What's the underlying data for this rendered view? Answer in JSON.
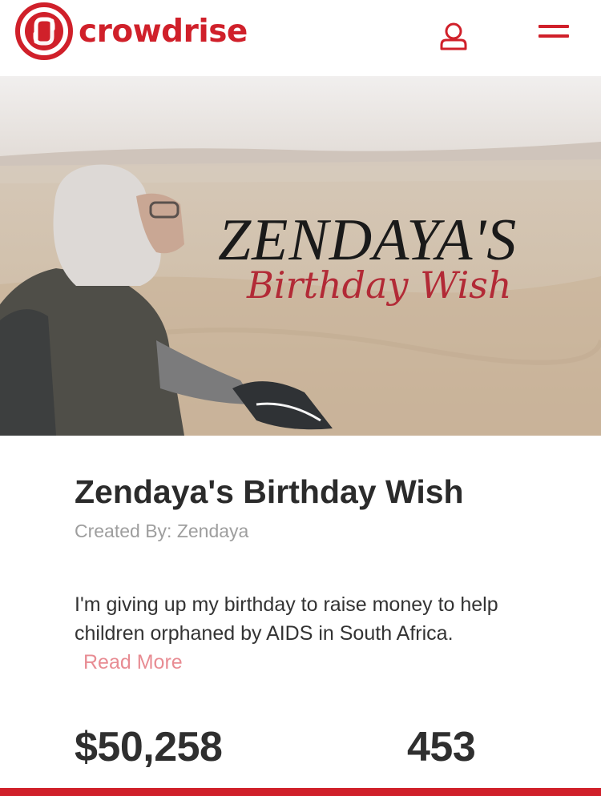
{
  "header": {
    "brand_name": "crowdrise",
    "brand_color": "#d0202a",
    "user_icon": "user-icon",
    "menu_icon": "hamburger-menu-icon"
  },
  "hero": {
    "title": "ZENDAYA'S",
    "subtitle": "Birthday Wish"
  },
  "campaign": {
    "title": "Zendaya's Birthday Wish",
    "created_by": "Created By: Zendaya",
    "description": "I'm giving up my birthday to raise money to help children orphaned by AIDS in South Africa.",
    "read_more": "Read More",
    "amount_raised": "$50,258",
    "donor_count": "453",
    "progress_fraction": 1.0
  }
}
